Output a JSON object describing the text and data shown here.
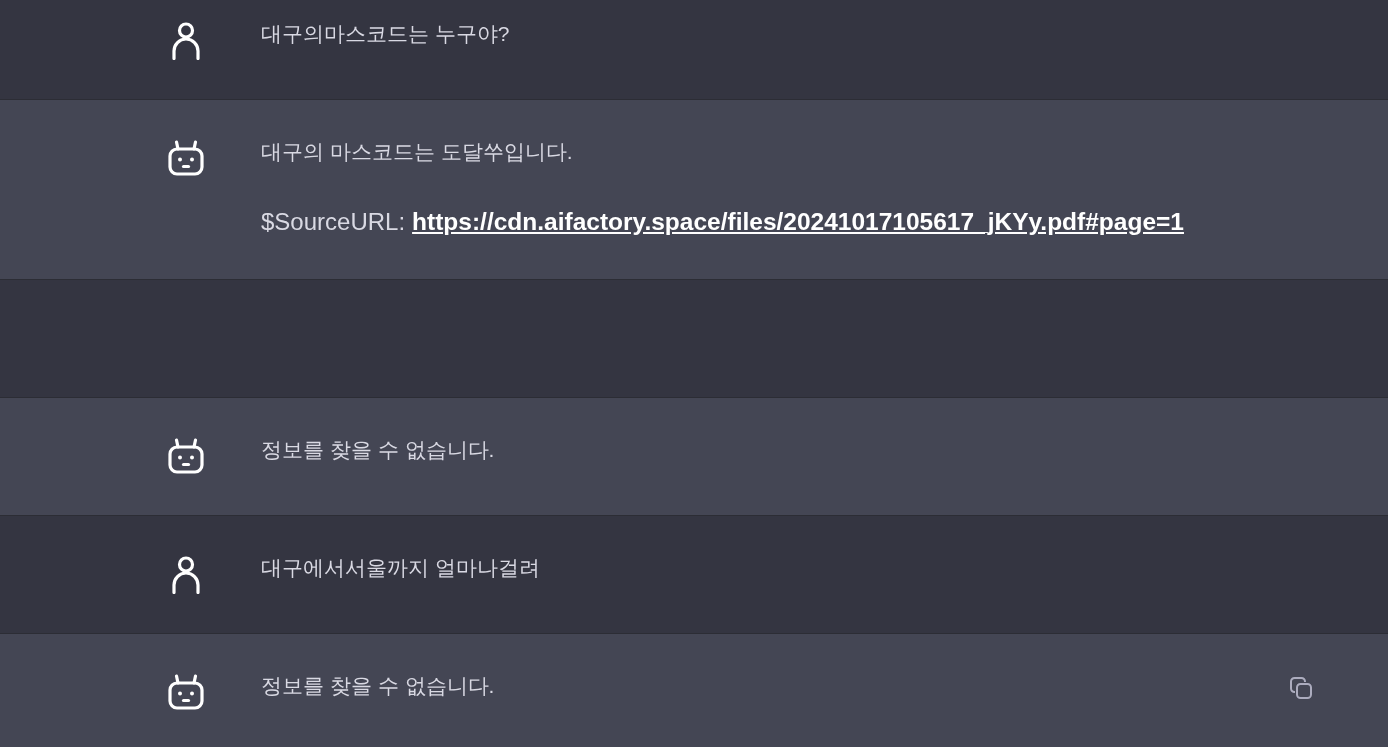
{
  "messages": [
    {
      "kind": "user",
      "hovered": false,
      "content": [
        {
          "kind": "text",
          "text": "대구의마스코드는 누구야?"
        }
      ]
    },
    {
      "kind": "bot",
      "hovered": false,
      "content": [
        {
          "kind": "text",
          "text": "대구의 마스코드는 도달쑤입니다."
        },
        {
          "kind": "source",
          "label": "$SourceURL:",
          "url": "https://cdn.aifactory.space/files/20241017105617_jKYy.pdf#page=1"
        }
      ]
    },
    {
      "kind": "empty",
      "hovered": false
    },
    {
      "kind": "bot",
      "hovered": false,
      "content": [
        {
          "kind": "text",
          "text": "정보를 찾을 수 없습니다."
        }
      ]
    },
    {
      "kind": "user",
      "hovered": false,
      "content": [
        {
          "kind": "text",
          "text": "대구에서서울까지 얼마나걸려"
        }
      ]
    },
    {
      "kind": "bot",
      "hovered": true,
      "content": [
        {
          "kind": "text",
          "text": "정보를 찾을 수 없습니다."
        }
      ]
    }
  ]
}
